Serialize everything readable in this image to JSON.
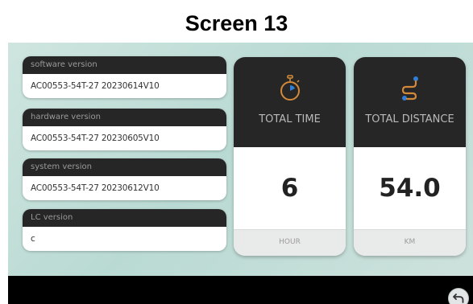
{
  "title": "Screen 13",
  "info": [
    {
      "label": "software version",
      "value": "AC00553-54T-27 20230614V10"
    },
    {
      "label": "hardware version",
      "value": "AC00553-54T-27 20230605V10"
    },
    {
      "label": "system version",
      "value": "AC00553-54T-27 20230612V10"
    },
    {
      "label": "LC version",
      "value": "c"
    }
  ],
  "stats": [
    {
      "label": "TOTAL TIME",
      "value": "6",
      "unit": "HOUR",
      "icon": "stopwatch-icon"
    },
    {
      "label": "TOTAL DISTANCE",
      "value": "54.0",
      "unit": "KM",
      "icon": "route-icon"
    }
  ],
  "colors": {
    "accent": "#2f7fd8",
    "card_header": "#262626",
    "background": "#c3ddd7"
  },
  "back_icon": "back-arrow-icon"
}
